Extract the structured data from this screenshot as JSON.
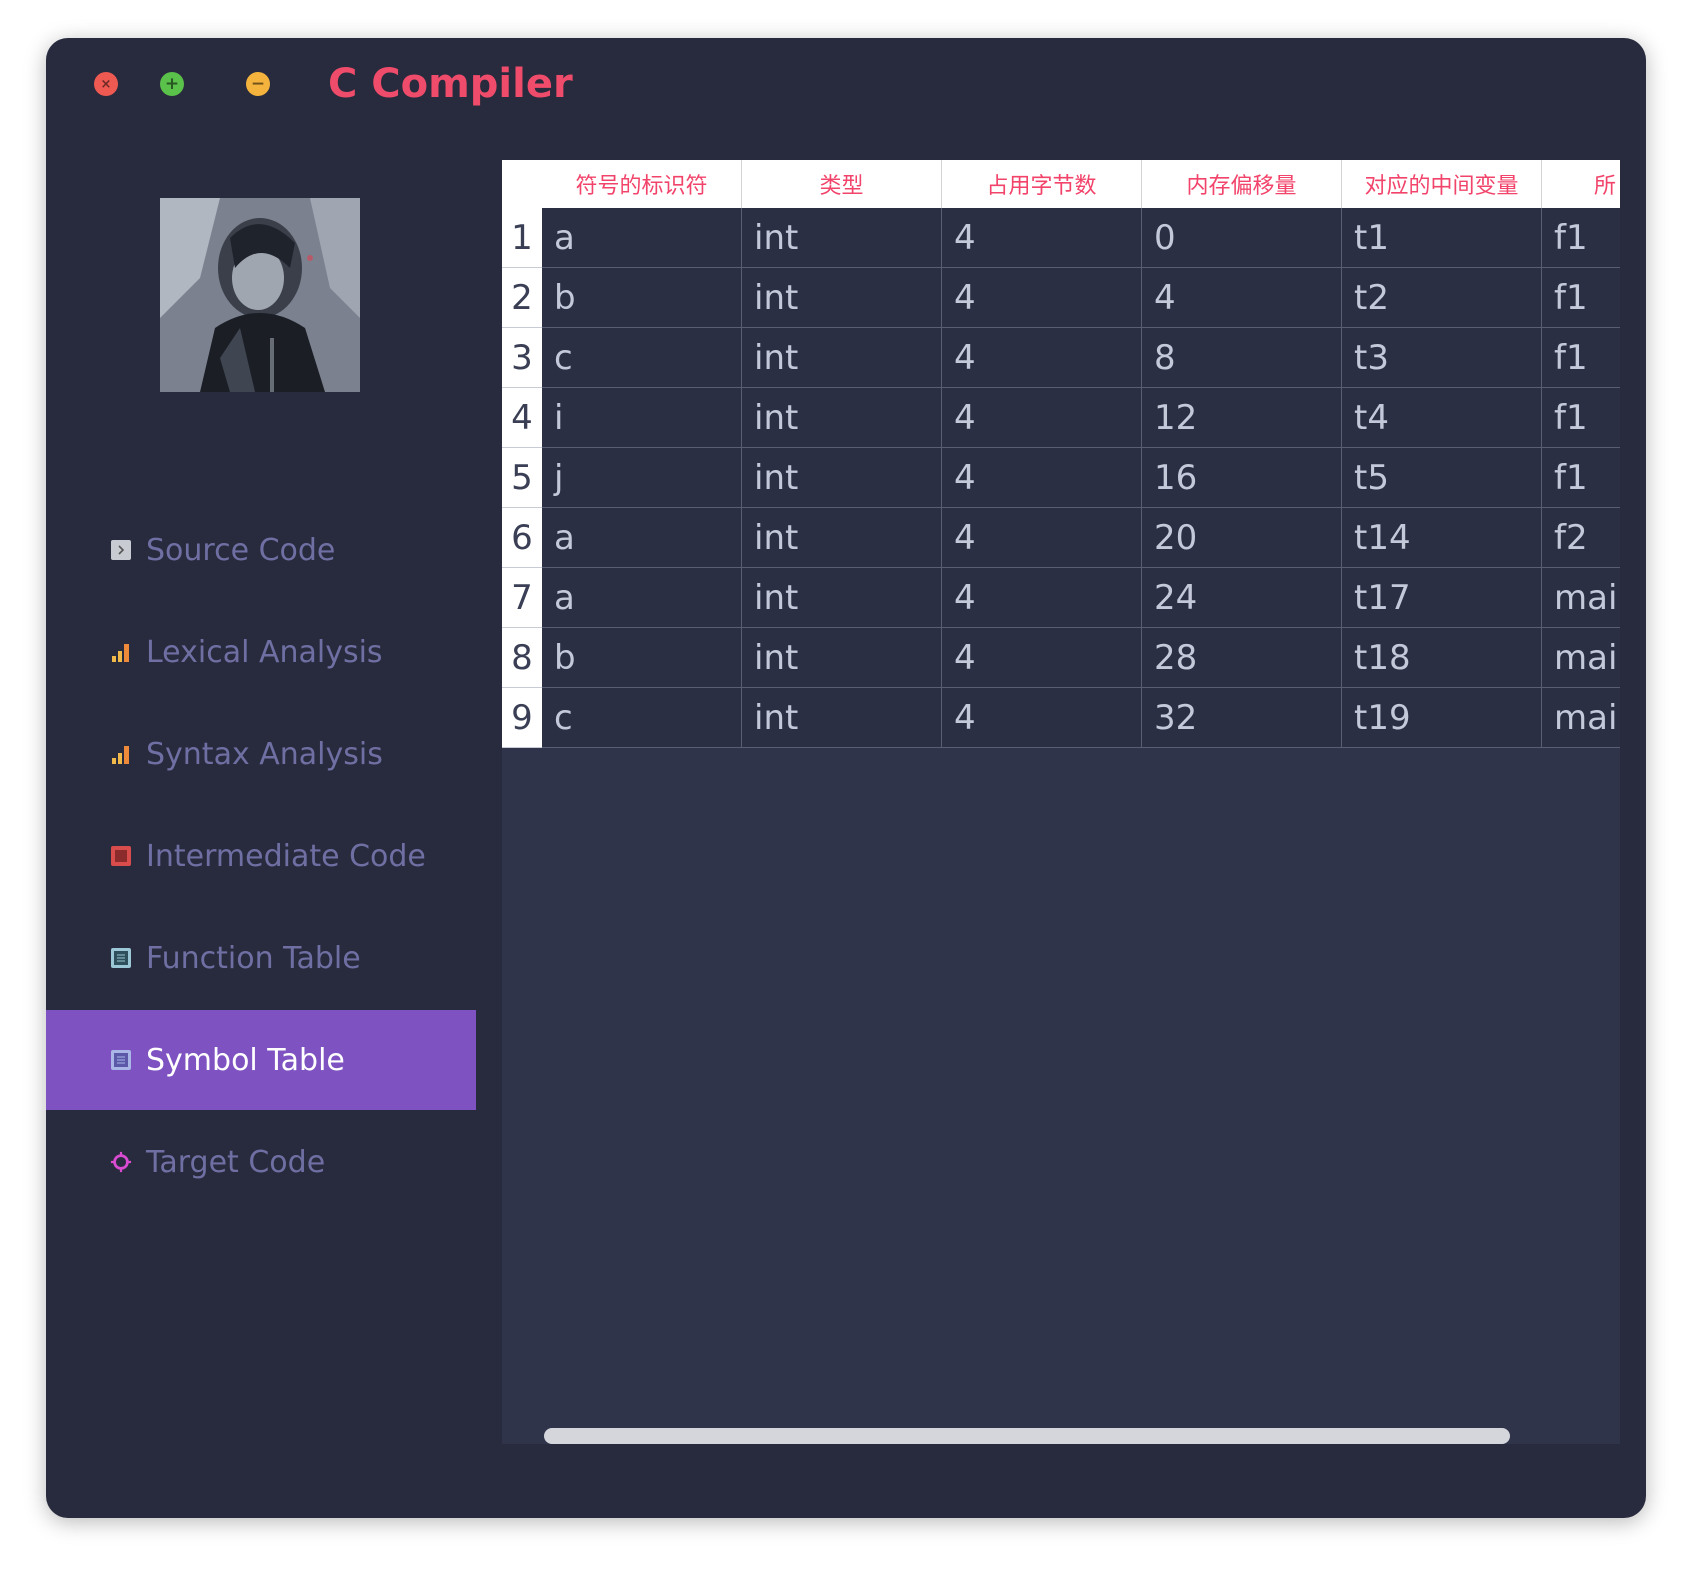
{
  "window": {
    "title": "C Compiler",
    "controls": {
      "close": "×",
      "add": "+",
      "minimize": "−"
    }
  },
  "sidebar": {
    "items": [
      {
        "label": "Source Code",
        "icon": "source-code-icon",
        "active": false
      },
      {
        "label": "Lexical Analysis",
        "icon": "bar-chart-icon",
        "active": false
      },
      {
        "label": "Syntax Analysis",
        "icon": "bar-chart-icon",
        "active": false
      },
      {
        "label": "Intermediate Code",
        "icon": "square-icon",
        "active": false
      },
      {
        "label": "Function Table",
        "icon": "table-icon",
        "active": false
      },
      {
        "label": "Symbol Table",
        "icon": "table-icon",
        "active": true
      },
      {
        "label": "Target Code",
        "icon": "target-icon",
        "active": false
      }
    ]
  },
  "table": {
    "headers": [
      "符号的标识符",
      "类型",
      "占用字节数",
      "内存偏移量",
      "对应的中间变量",
      "所"
    ],
    "row_numbers": [
      "1",
      "2",
      "3",
      "4",
      "5",
      "6",
      "7",
      "8",
      "9"
    ],
    "rows": [
      [
        "a",
        "int",
        "4",
        "0",
        "t1",
        "f1"
      ],
      [
        "b",
        "int",
        "4",
        "4",
        "t2",
        "f1"
      ],
      [
        "c",
        "int",
        "4",
        "8",
        "t3",
        "f1"
      ],
      [
        "i",
        "int",
        "4",
        "12",
        "t4",
        "f1"
      ],
      [
        "j",
        "int",
        "4",
        "16",
        "t5",
        "f1"
      ],
      [
        "a",
        "int",
        "4",
        "20",
        "t14",
        "f2"
      ],
      [
        "a",
        "int",
        "4",
        "24",
        "t17",
        "main"
      ],
      [
        "b",
        "int",
        "4",
        "28",
        "t18",
        "main"
      ],
      [
        "c",
        "int",
        "4",
        "32",
        "t19",
        "main"
      ]
    ]
  },
  "colors": {
    "accent": "#7f52c2",
    "title": "#ef4b6a",
    "header_text": "#f2446b",
    "window_bg": "#282b3d",
    "content_bg": "#30344b"
  }
}
